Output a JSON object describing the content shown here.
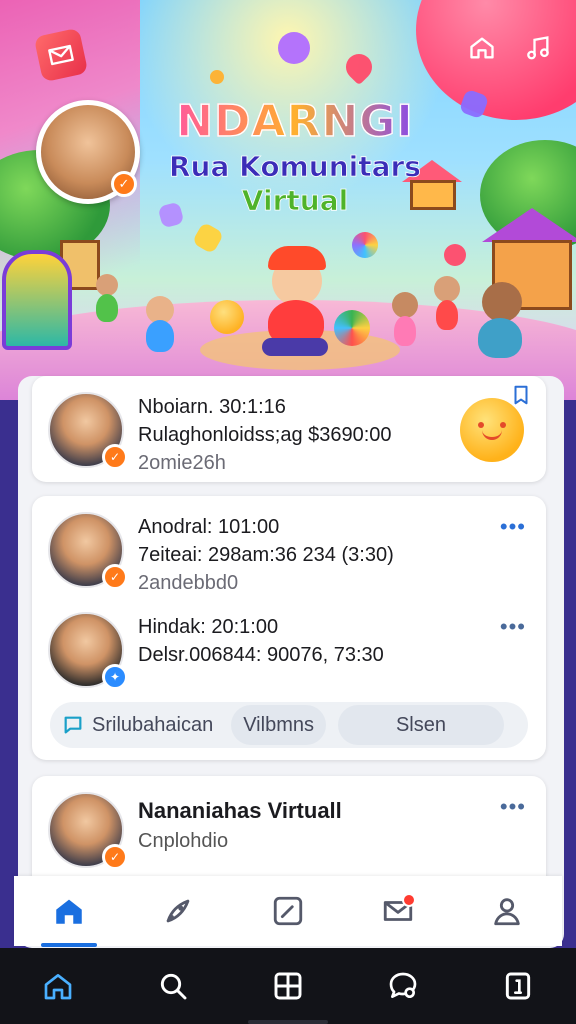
{
  "hero": {
    "title_line1": "NDARNGI",
    "title_line2": "Rua Komunitars",
    "title_line3": "Virtual",
    "icons": [
      "envelope-icon",
      "home-icon",
      "music-icon"
    ]
  },
  "feed": {
    "card1": {
      "line1": "Nboiarn. 30:1:16",
      "line2": "Rulaghonloidss;ag $3690:00",
      "line3": "2omie26h"
    },
    "card2": {
      "row1": {
        "line1": "Anodral: 101:00",
        "line2": "7eiteai: 298am:36 234 (3:30)",
        "line3": "2andebbd0"
      },
      "row2": {
        "line1": "Hindak: 20:1:00",
        "line2": "Delsr.006844: 90076, 73:30"
      },
      "chips": [
        "Srilubahaican",
        "Vilbmns",
        "Slsen"
      ]
    },
    "card3": {
      "title": "Nananiahas Virtuall",
      "subtitle": "Cnplohdio"
    }
  },
  "app_nav": {
    "items": [
      "home",
      "rocket",
      "edit",
      "messages",
      "profile"
    ],
    "active": "home",
    "notification": true
  },
  "system_nav": {
    "items": [
      "home",
      "search",
      "grid",
      "chat",
      "book"
    ]
  },
  "colors": {
    "accent": "#1a6fe0",
    "badge_orange": "#ff7a1a",
    "badge_blue": "#2b8cff",
    "notification": "#ff3b30"
  }
}
